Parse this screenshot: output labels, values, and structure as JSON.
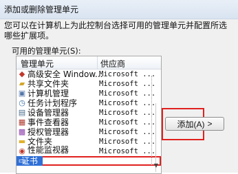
{
  "window": {
    "title": "添加或删除管理单元"
  },
  "description": {
    "line1": "您可以在计算机上为此控制台选择可用的管理单元并配置所选",
    "line2": "哪些扩展项。"
  },
  "available_list": {
    "label": "可用的管理单元(S):",
    "columns": {
      "name": "管理单元",
      "vendor": "供应商"
    },
    "rows": [
      {
        "icon": "firewall-icon",
        "name": "高级安全 Window...",
        "vendor": "Microsoft ..."
      },
      {
        "icon": "shared-folder-icon",
        "name": "共享文件夹",
        "vendor": "Microsoft ..."
      },
      {
        "icon": "computer-management-icon",
        "name": "计算机管理",
        "vendor": "Microsoft ..."
      },
      {
        "icon": "task-scheduler-icon",
        "name": "任务计划程序",
        "vendor": "Microsoft ..."
      },
      {
        "icon": "device-manager-icon",
        "name": "设备管理器",
        "vendor": "Microsoft ..."
      },
      {
        "icon": "event-viewer-icon",
        "name": "事件查看器",
        "vendor": "Microsoft ..."
      },
      {
        "icon": "authorization-manager-icon",
        "name": "授权管理器",
        "vendor": "Microsoft ..."
      },
      {
        "icon": "folder-icon",
        "name": "文件夹",
        "vendor": "Microsoft ..."
      },
      {
        "icon": "performance-monitor-icon",
        "name": "性能监视器",
        "vendor": "Microsoft ..."
      },
      {
        "icon": "certificates-icon",
        "name": "证书",
        "vendor": ""
      }
    ]
  },
  "buttons": {
    "add_label": "添加(A)",
    "add_chevron": ">"
  },
  "colors": {
    "highlight": "#e0201e",
    "selection": "#2f6fd6"
  }
}
